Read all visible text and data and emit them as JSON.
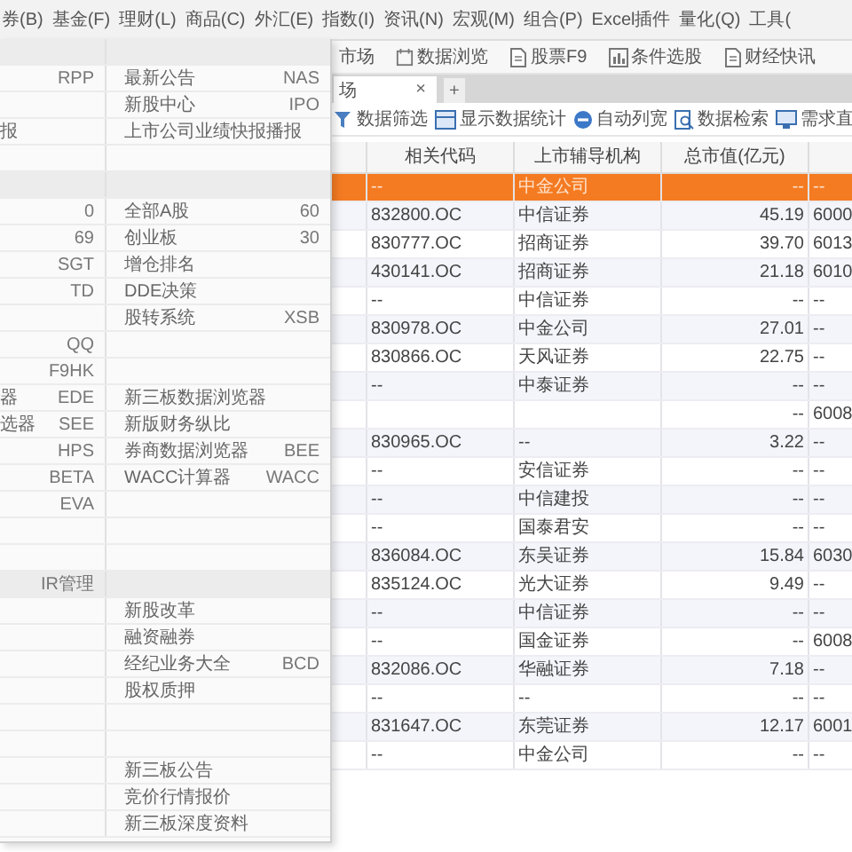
{
  "menu_bar": [
    "券(B)",
    "基金(F)",
    "理财(L)",
    "商品(C)",
    "外汇(E)",
    "指数(I)",
    "资讯(N)",
    "宏观(M)",
    "组合(P)",
    "Excel插件",
    "量化(Q)",
    "工具("
  ],
  "toolbar": [
    "市场",
    "数据浏览",
    "股票F9",
    "条件选股",
    "财经快讯"
  ],
  "tabs": [
    {
      "label": "场",
      "selected": true
    }
  ],
  "new_tab": "+",
  "close": "×",
  "actions": [
    "数据筛选",
    "显示数据统计",
    "自动列宽",
    "数据检索",
    "需求直"
  ],
  "table": {
    "columns": [
      "相关代码",
      "上市辅导机构",
      "总市值(亿元)"
    ],
    "rows": [
      {
        "code": "--",
        "org": "中金公司",
        "cap": "--",
        "column_5": "--",
        "selected": true
      },
      {
        "code": "832800.OC",
        "org": "中信证券",
        "cap": "45.19",
        "column_5": "6000",
        "selected": false
      },
      {
        "code": "830777.OC",
        "org": "招商证券",
        "cap": "39.70",
        "column_5": "6013",
        "selected": false
      },
      {
        "code": "430141.OC",
        "org": "招商证券",
        "cap": "21.18",
        "column_5": "6010",
        "selected": false
      },
      {
        "code": "--",
        "org": "中信证券",
        "cap": "--",
        "column_5": "--",
        "selected": false
      },
      {
        "code": "830978.OC",
        "org": "中金公司",
        "cap": "27.01",
        "column_5": "--",
        "selected": false
      },
      {
        "code": "830866.OC",
        "org": "天风证券",
        "cap": "22.75",
        "column_5": "--",
        "selected": false
      },
      {
        "code": "--",
        "org": "中泰证券",
        "cap": "--",
        "column_5": "--",
        "selected": false
      },
      {
        "cap": "--",
        "column_5": "6008",
        "selected": false
      },
      {
        "code": "830965.OC",
        "org": "--",
        "cap": "3.22",
        "column_5": "--",
        "selected": false
      },
      {
        "code": "--",
        "org": "安信证券",
        "cap": "--",
        "column_5": "--",
        "selected": false
      },
      {
        "code": "--",
        "org": "中信建投",
        "cap": "--",
        "column_5": "--",
        "selected": false
      },
      {
        "code": "--",
        "org": "国泰君安",
        "cap": "--",
        "column_5": "--",
        "selected": false
      },
      {
        "code": "836084.OC",
        "org": "东吴证券",
        "cap": "15.84",
        "column_5": "6030",
        "selected": false
      },
      {
        "code": "835124.OC",
        "org": "光大证券",
        "cap": "9.49",
        "column_5": "--",
        "selected": false
      },
      {
        "code": "--",
        "org": "中信证券",
        "cap": "--",
        "column_5": "--",
        "selected": false
      },
      {
        "code": "--",
        "org": "国金证券",
        "cap": "--",
        "column_5": "6008",
        "selected": false
      },
      {
        "code": "832086.OC",
        "org": "华融证券",
        "cap": "7.18",
        "column_5": "--",
        "selected": false
      },
      {
        "code": "--",
        "org": "--",
        "cap": "--",
        "column_5": "--",
        "selected": false
      },
      {
        "code": "831647.OC",
        "org": "东莞证券",
        "cap": "12.17",
        "column_5": "6001",
        "selected": false
      },
      {
        "code": "--",
        "org": "中金公司",
        "cap": "--",
        "column_5": "--",
        "selected": false
      }
    ]
  },
  "dropdown": [
    {
      "kind": "section"
    },
    {
      "kind": "item",
      "left_key": "RPP",
      "right": "最新公告",
      "right_key": "NAS"
    },
    {
      "kind": "item",
      "right": "新股中心",
      "right_key": "IPO"
    },
    {
      "kind": "item",
      "left": "报",
      "right": "上市公司业绩快报播报"
    },
    {
      "kind": "item"
    },
    {
      "kind": "section"
    },
    {
      "kind": "item",
      "left_key": "0",
      "right": "全部A股",
      "right_key": "60"
    },
    {
      "kind": "item",
      "left_key": "69",
      "right": "创业板",
      "right_key": "30"
    },
    {
      "kind": "item",
      "left_key": "SGT",
      "right": "增仓排名"
    },
    {
      "kind": "item",
      "left_key": "TD",
      "right": "DDE决策"
    },
    {
      "kind": "item",
      "right": "股转系统",
      "right_key": "XSB"
    },
    {
      "kind": "item",
      "left_key": "QQ"
    },
    {
      "kind": "item",
      "left_key": "F9HK"
    },
    {
      "kind": "item",
      "left": "器",
      "left_key": "EDE",
      "right": "新三板数据浏览器"
    },
    {
      "kind": "item",
      "left": "选器",
      "left_key": "SEE",
      "right": "新版财务纵比"
    },
    {
      "kind": "item",
      "left_key": "HPS",
      "right": "券商数据浏览器",
      "right_key": "BEE"
    },
    {
      "kind": "item",
      "left_key": "BETA",
      "right": "WACC计算器",
      "right_key": "WACC"
    },
    {
      "kind": "item",
      "left_key": "EVA"
    },
    {
      "kind": "item"
    },
    {
      "kind": "item"
    },
    {
      "kind": "section",
      "left_key": "IR管理"
    },
    {
      "kind": "item",
      "right": "新股改革"
    },
    {
      "kind": "item",
      "right": "融资融券"
    },
    {
      "kind": "item",
      "right": "经纪业务大全",
      "right_key": "BCD"
    },
    {
      "kind": "item",
      "right": "股权质押"
    },
    {
      "kind": "item"
    },
    {
      "kind": "item"
    },
    {
      "kind": "item",
      "right": "新三板公告"
    },
    {
      "kind": "item",
      "right": "竞价行情报价"
    },
    {
      "kind": "item",
      "right": "新三板深度资料"
    }
  ]
}
